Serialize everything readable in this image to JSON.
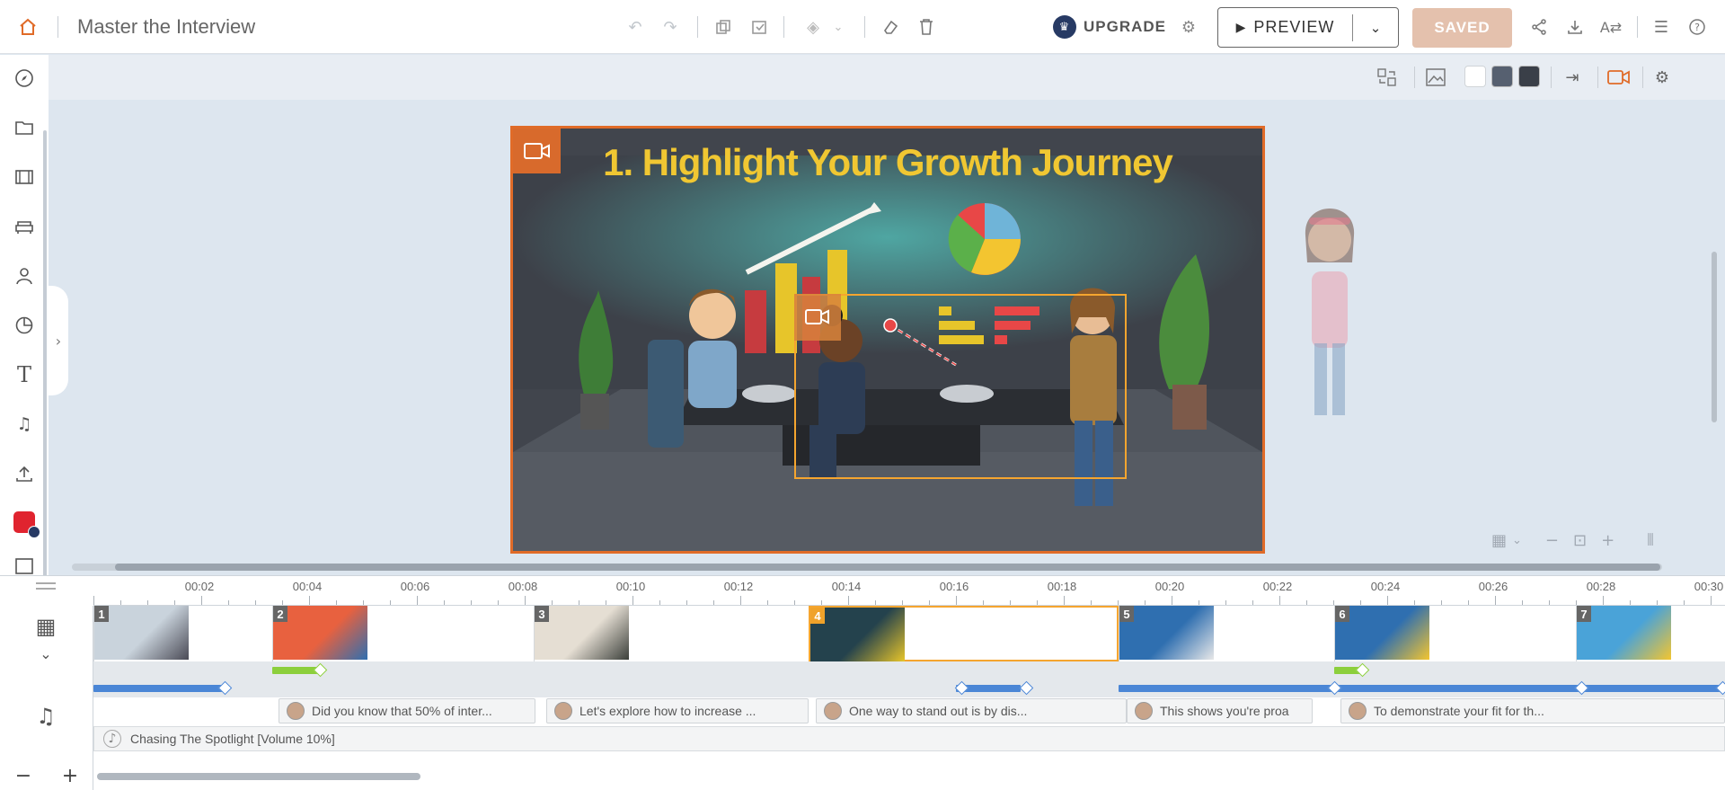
{
  "header": {
    "title": "Master the Interview",
    "upgrade_label": "UPGRADE",
    "preview_label": "PREVIEW",
    "saved_label": "SAVED"
  },
  "stage": {
    "scene_title": "1. Highlight Your Growth Journey"
  },
  "timeline": {
    "ruler_labels": [
      "00:02",
      "00:04",
      "00:06",
      "00:08",
      "00:10",
      "00:12",
      "00:14",
      "00:16",
      "00:18",
      "00:20",
      "00:22",
      "00:24",
      "00:26",
      "00:28",
      "00:30"
    ],
    "scenes": [
      {
        "num": "1"
      },
      {
        "num": "2"
      },
      {
        "num": "3"
      },
      {
        "num": "4"
      },
      {
        "num": "5"
      },
      {
        "num": "6"
      },
      {
        "num": "7"
      }
    ],
    "voice_clips": [
      "Did you know that 50% of inter...",
      "Let's explore how to increase ...",
      "One way to stand out is by dis...",
      "This shows you're proa",
      "To demonstrate your fit for th..."
    ],
    "music_label": "Chasing The Spotlight [Volume 10%]"
  },
  "colors": {
    "accent": "#e06b28",
    "selection": "#f5a52f",
    "saved_bg": "#e4c1ad",
    "camera_bar": "#4a86d6",
    "transition_bar": "#8ccf3c",
    "title_yellow": "#f0c732"
  },
  "icons": {
    "home": "home-icon",
    "undo": "undo-icon",
    "redo": "redo-icon",
    "copy": "copy-icon",
    "paste": "paste-icon",
    "layers": "layers-icon",
    "clear": "eraser-icon",
    "delete": "trash-icon",
    "settings": "gear-icon",
    "share": "share-icon",
    "download": "download-icon",
    "translate": "translate-icon",
    "notes": "notes-icon",
    "help": "help-icon"
  }
}
